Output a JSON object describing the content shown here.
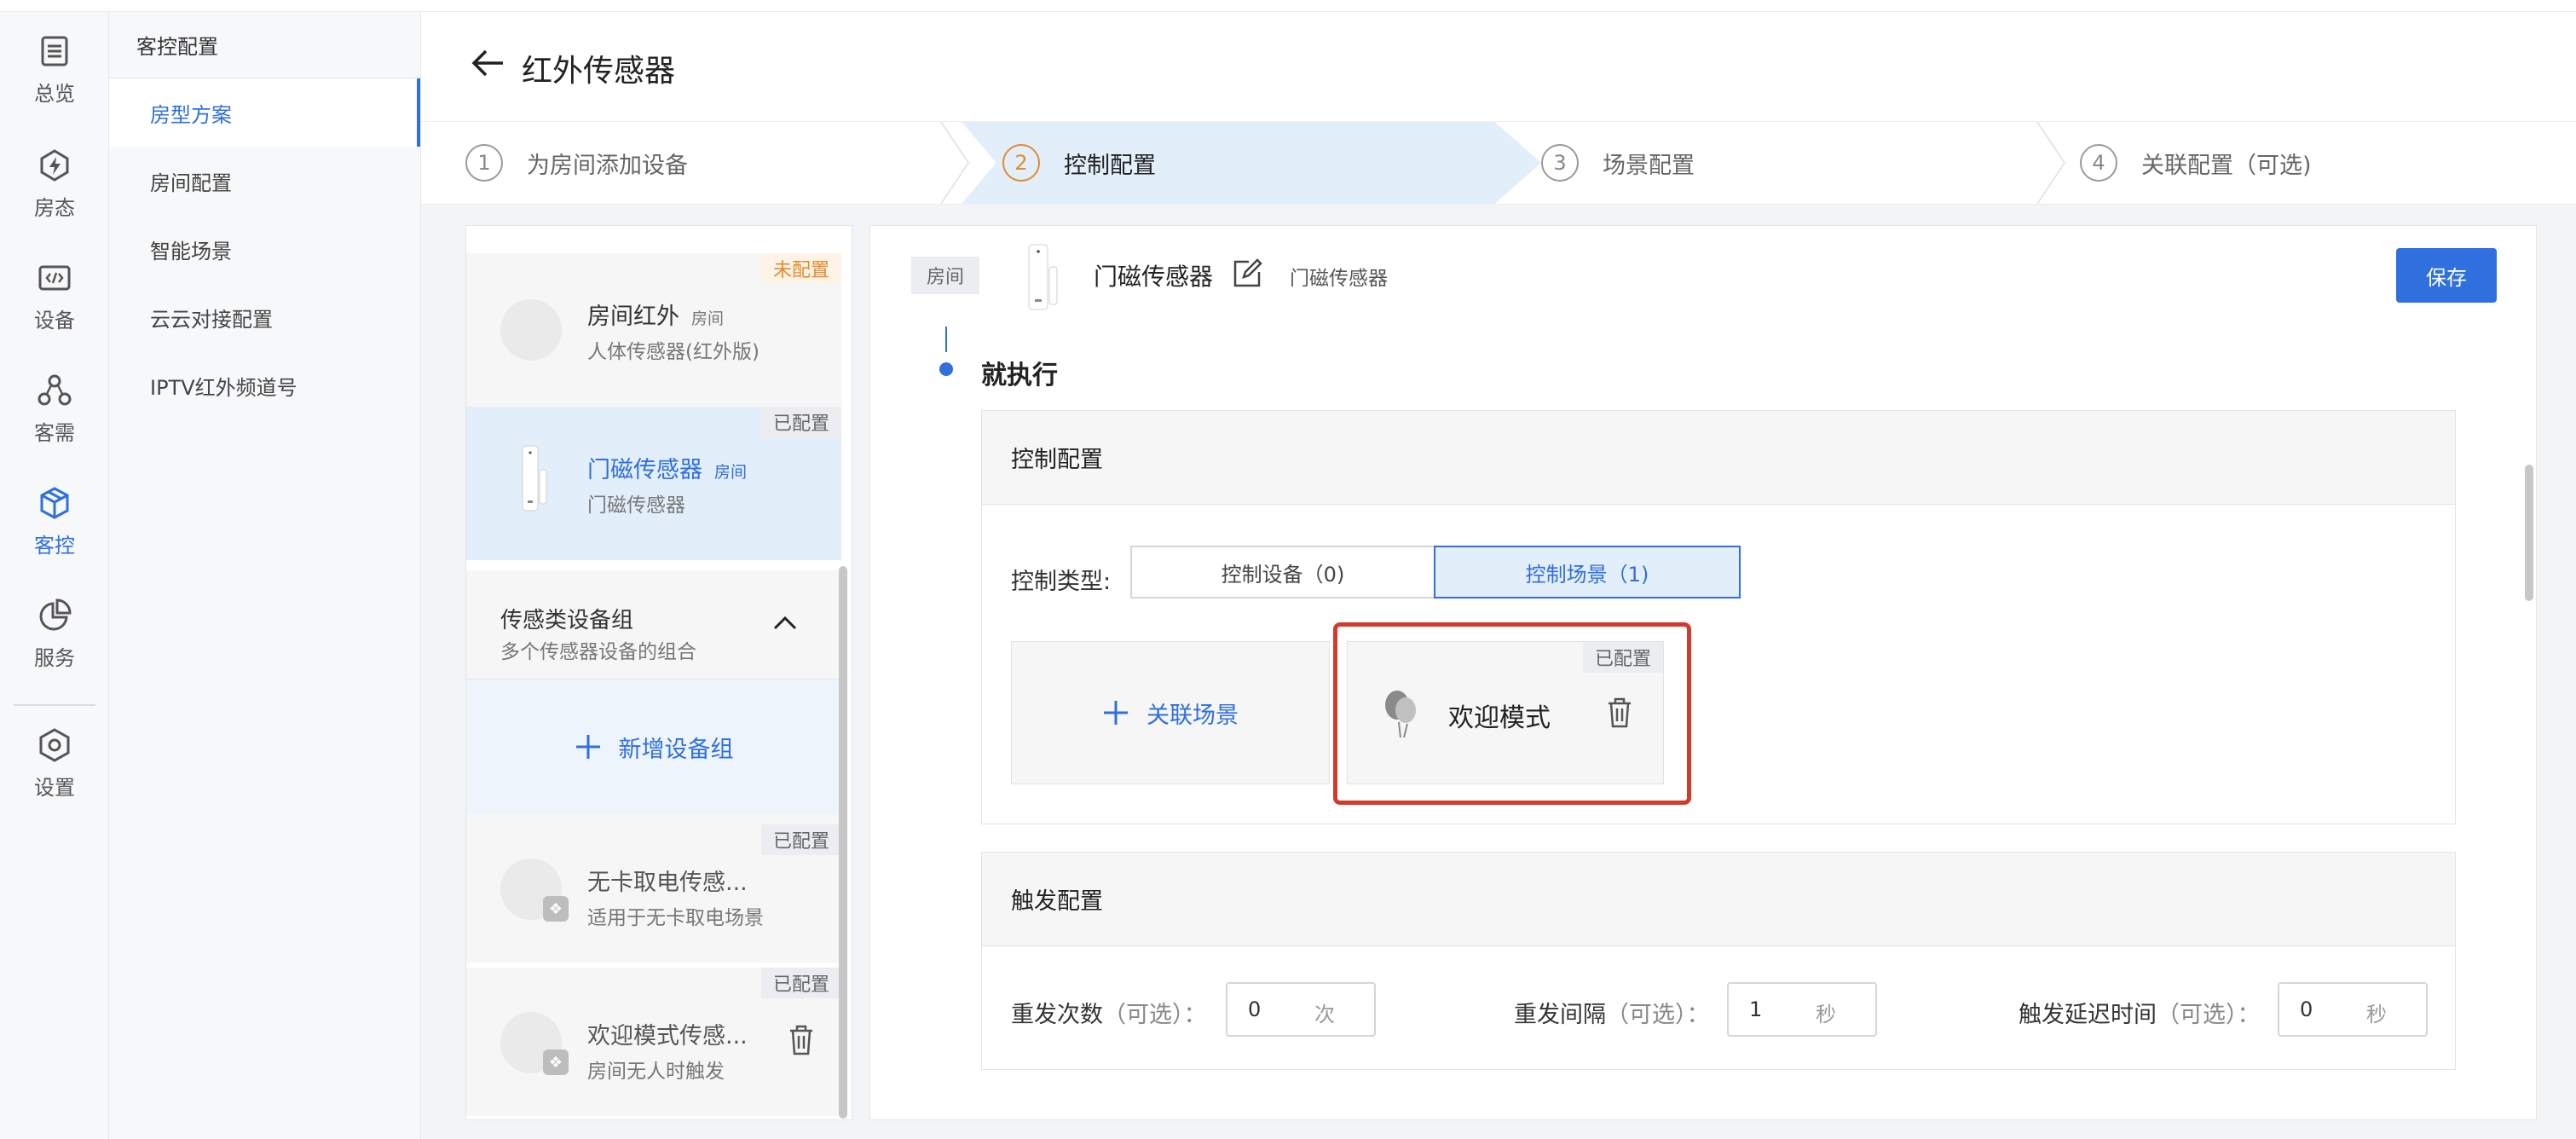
{
  "rail": {
    "items": [
      {
        "label": "总览",
        "icon": "list-icon"
      },
      {
        "label": "房态",
        "icon": "bolt-icon"
      },
      {
        "label": "设备",
        "icon": "code-icon"
      },
      {
        "label": "客需",
        "icon": "nodes-icon"
      },
      {
        "label": "客控",
        "icon": "cube-icon"
      },
      {
        "label": "服务",
        "icon": "pie-icon"
      },
      {
        "label": "设置",
        "icon": "hexagon-settings-icon"
      }
    ],
    "active": "客控"
  },
  "subnav": {
    "title": "客控配置",
    "items": [
      "房型方案",
      "房间配置",
      "智能场景",
      "云云对接配置",
      "IPTV红外频道号"
    ],
    "active": "房型方案"
  },
  "page": {
    "title": "红外传感器"
  },
  "steps": [
    {
      "num": "1",
      "label": "为房间添加设备"
    },
    {
      "num": "2",
      "label": "控制配置"
    },
    {
      "num": "3",
      "label": "场景配置"
    },
    {
      "num": "4",
      "label": "关联配置（可选)"
    }
  ],
  "device_list": {
    "cards": [
      {
        "name": "房间红外",
        "room": "房间",
        "sub": "人体传感器(红外版)",
        "tag": "未配置"
      },
      {
        "name": "门磁传感器",
        "room": "房间",
        "sub": "门磁传感器",
        "tag": "已配置"
      }
    ],
    "group": {
      "title": "传感类设备组",
      "sub": "多个传感器设备的组合"
    },
    "add_group_label": "新增设备组",
    "group_cards": [
      {
        "name": "无卡取电传感...",
        "sub": "适用于无卡取电场景",
        "tag": "已配置"
      },
      {
        "name": "欢迎模式传感...",
        "sub": "房间无人时触发",
        "tag": "已配置"
      }
    ]
  },
  "config": {
    "room_chip": "房间",
    "device_name": "门磁传感器",
    "device_sub": "门磁传感器",
    "save_label": "保存",
    "exec_title": "就执行",
    "control": {
      "title": "控制配置",
      "type_label": "控制类型:",
      "options": [
        "控制设备（0)",
        "控制场景（1)"
      ],
      "active_option": "控制场景（1)",
      "add_scene_label": "关联场景",
      "scene": {
        "name": "欢迎模式",
        "tag": "已配置"
      }
    },
    "trigger": {
      "title": "触发配置",
      "fields": [
        {
          "label": "重发次数",
          "optional": "（可选）：",
          "value": "0",
          "unit": "次"
        },
        {
          "label": "重发间隔",
          "optional": "（可选）：",
          "value": "1",
          "unit": "秒"
        },
        {
          "label": "触发延迟时间",
          "optional": "（可选）：",
          "value": "0",
          "unit": "秒"
        }
      ]
    }
  },
  "colors": {
    "accent": "#2f6fde",
    "active_step_num": "#e28a2e",
    "highlight": "#d43a2c"
  }
}
